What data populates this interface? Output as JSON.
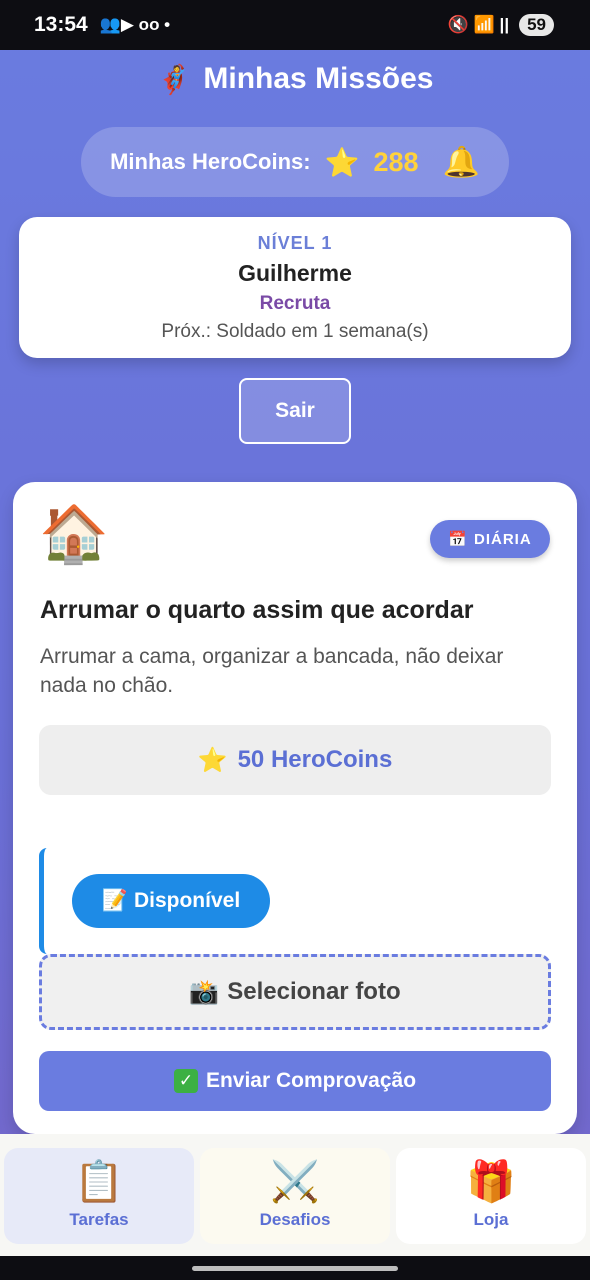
{
  "status_bar": {
    "time": "13:54",
    "left_icons": "👥▶ ᴏᴏ •",
    "right_icons": "🔇 📶 ||",
    "battery": "59"
  },
  "header": {
    "title_icon": "🦸",
    "title": "Minhas Missões",
    "coins_label": "Minhas HeroCoins:",
    "star_icon": "⭐",
    "coins_value": "288",
    "bell_icon": "🔔"
  },
  "level_card": {
    "level": "NÍVEL 1",
    "name": "Guilherme",
    "rank": "Recruta",
    "next": "Próx.: Soldado em 1 semana(s)"
  },
  "logout_label": "Sair",
  "task": {
    "icon": "🏠",
    "badge_icon": "📅",
    "badge_label": "DIÁRIA",
    "title": "Arrumar o quarto assim que acordar",
    "description": "Arrumar a cama, organizar a bancada, não deixar nada no chão.",
    "reward_icon": "⭐",
    "reward": "50 HeroCoins",
    "status_icon": "📝",
    "status": "Disponível",
    "photo_icon": "📸",
    "photo_label": "Selecionar foto",
    "submit_icon": "✓",
    "submit_label": "Enviar Comprovação"
  },
  "nav": [
    {
      "icon": "📋",
      "label": "Tarefas"
    },
    {
      "icon": "⚔️",
      "label": "Desafios"
    },
    {
      "icon": "🎁",
      "label": "Loja"
    }
  ]
}
